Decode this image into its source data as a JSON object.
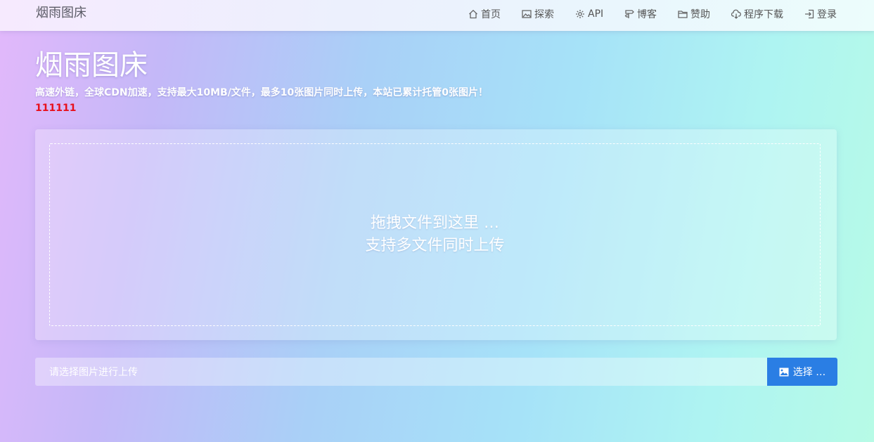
{
  "navbar": {
    "brand": "烟雨图床",
    "items": [
      {
        "label": "首页",
        "icon": "home-icon"
      },
      {
        "label": "探索",
        "icon": "image-icon"
      },
      {
        "label": "API",
        "icon": "gear-icon"
      },
      {
        "label": "博客",
        "icon": "signpost-icon"
      },
      {
        "label": "赞助",
        "icon": "folder-icon"
      },
      {
        "label": "程序下载",
        "icon": "cloud-download-icon"
      },
      {
        "label": "登录",
        "icon": "login-icon"
      }
    ]
  },
  "hero": {
    "title": "烟雨图床",
    "subtitle": "高速外链，全球CDN加速，支持最大10MB/文件，最多10张图片同时上传，本站已累计托管0张图片！",
    "notice": "111111"
  },
  "upload": {
    "drop_line1": "拖拽文件到这里 …",
    "drop_line2": "支持多文件同时上传",
    "input_placeholder": "请选择图片进行上传",
    "select_label": "选择 …"
  },
  "colors": {
    "accent": "#2a7ee4",
    "notice": "#e8101c"
  }
}
